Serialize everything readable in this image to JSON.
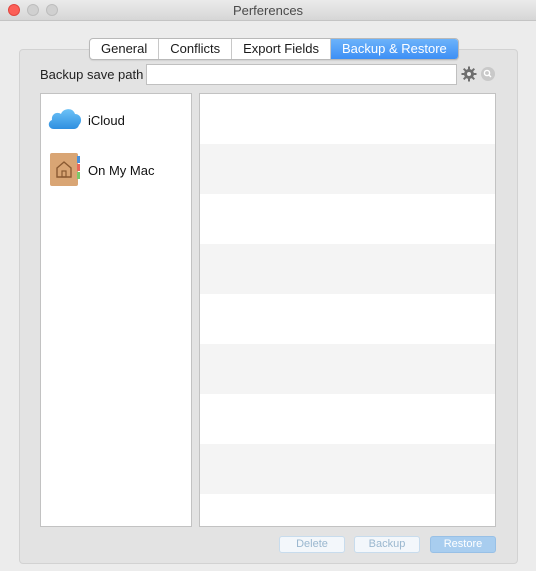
{
  "window": {
    "title": "Perferences"
  },
  "tabs": [
    {
      "label": "General",
      "active": false
    },
    {
      "label": "Conflicts",
      "active": false
    },
    {
      "label": "Export Fields",
      "active": false
    },
    {
      "label": "Backup & Restore",
      "active": true
    }
  ],
  "backup": {
    "path_label": "Backup save path",
    "path_value": "",
    "settings_icon": "gear-icon",
    "search_icon": "search-icon"
  },
  "sidebar": {
    "items": [
      {
        "label": "iCloud",
        "icon": "icloud-icon"
      },
      {
        "label": "On My Mac",
        "icon": "home-folder-icon"
      }
    ]
  },
  "buttons": {
    "delete": "Delete",
    "backup": "Backup",
    "restore": "Restore"
  },
  "colors": {
    "accent": "#3d8ff5",
    "close": "#fc5f57",
    "cloud": "#4aa8ec",
    "folder": "#d9a574"
  }
}
